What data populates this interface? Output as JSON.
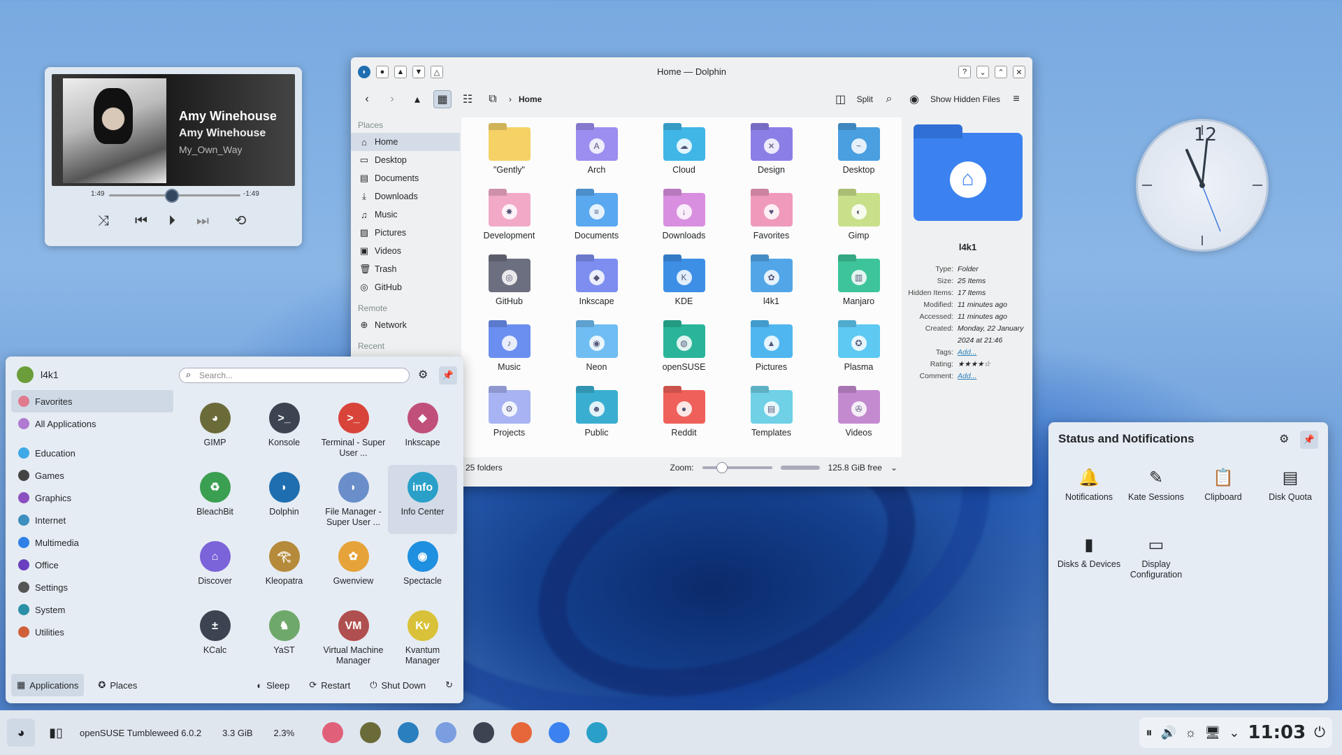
{
  "media": {
    "artist": "Amy Winehouse",
    "album": "Amy Winehouse",
    "track": "My_Own_Way",
    "elapsed": "1:49",
    "remaining": "-1:49",
    "progress": 0.5
  },
  "dolphin": {
    "title": "Home — Dolphin",
    "breadcrumb": "Home",
    "split_label": "Split",
    "hidden_label": "Show Hidden Files",
    "places_header": "Places",
    "remote_header": "Remote",
    "recent_header": "Recent",
    "places": [
      "Home",
      "Desktop",
      "Documents",
      "Downloads",
      "Music",
      "Pictures",
      "Videos",
      "Trash",
      "GitHub"
    ],
    "remote": [
      "Network"
    ],
    "folders": [
      {
        "name": "\"Gently\"",
        "color": "#f5d166",
        "sym": ""
      },
      {
        "name": "Arch",
        "color": "#9b8ef0",
        "sym": "A"
      },
      {
        "name": "Cloud",
        "color": "#3fb6e6",
        "sym": "☁"
      },
      {
        "name": "Design",
        "color": "#8b7fe6",
        "sym": "✕"
      },
      {
        "name": "Desktop",
        "color": "#4a9fe0",
        "sym": "~"
      },
      {
        "name": "Development",
        "color": "#f2a9c7",
        "sym": "✸"
      },
      {
        "name": "Documents",
        "color": "#5aa8ef",
        "sym": "≡"
      },
      {
        "name": "Downloads",
        "color": "#d98fe0",
        "sym": "↓"
      },
      {
        "name": "Favorites",
        "color": "#f09abb",
        "sym": "♥"
      },
      {
        "name": "Gimp",
        "color": "#c9e08a",
        "sym": "◐"
      },
      {
        "name": "GitHub",
        "color": "#6c6f7f",
        "sym": "◎"
      },
      {
        "name": "Inkscape",
        "color": "#7d8ef0",
        "sym": "◆"
      },
      {
        "name": "KDE",
        "color": "#3d8fe6",
        "sym": "K"
      },
      {
        "name": "l4k1",
        "color": "#52a6e8",
        "sym": "✿"
      },
      {
        "name": "Manjaro",
        "color": "#3dc49a",
        "sym": "▥"
      },
      {
        "name": "Music",
        "color": "#6b8ff0",
        "sym": "♪"
      },
      {
        "name": "Neon",
        "color": "#6fbdf2",
        "sym": "◉"
      },
      {
        "name": "openSUSE",
        "color": "#2ab59a",
        "sym": "◍"
      },
      {
        "name": "Pictures",
        "color": "#4fb6f0",
        "sym": "▲"
      },
      {
        "name": "Plasma",
        "color": "#5ec9f2",
        "sym": "✪"
      },
      {
        "name": "Projects",
        "color": "#a7b3f2",
        "sym": "⚙"
      },
      {
        "name": "Public",
        "color": "#3aaed0",
        "sym": "☻"
      },
      {
        "name": "Reddit",
        "color": "#f0605a",
        "sym": "●"
      },
      {
        "name": "Templates",
        "color": "#6fd0e6",
        "sym": "▤"
      },
      {
        "name": "Videos",
        "color": "#c48ad0",
        "sym": "✇"
      }
    ],
    "status": "25 folders",
    "zoom_label": "Zoom:",
    "free": "125.8 GiB free",
    "info": {
      "name": "l4k1",
      "rows": [
        {
          "k": "Type:",
          "v": "Folder"
        },
        {
          "k": "Size:",
          "v": "25 Items"
        },
        {
          "k": "Hidden Items:",
          "v": "17 Items"
        },
        {
          "k": "Modified:",
          "v": "11 minutes ago"
        },
        {
          "k": "Accessed:",
          "v": "11 minutes ago"
        },
        {
          "k": "Created:",
          "v": "Monday, 22 January 2024 at 21:46"
        },
        {
          "k": "Tags:",
          "v": "Add..."
        },
        {
          "k": "Rating:",
          "v": "★★★★☆"
        },
        {
          "k": "Comment:",
          "v": "Add..."
        }
      ]
    }
  },
  "launcher": {
    "user": "l4k1",
    "search_placeholder": "Search...",
    "categories": [
      {
        "name": "Favorites",
        "color": "#e07a8f"
      },
      {
        "name": "All Applications",
        "color": "#b07ad0"
      },
      {
        "name": "Education",
        "color": "#3da9e6"
      },
      {
        "name": "Games",
        "color": "#444"
      },
      {
        "name": "Graphics",
        "color": "#8b4fbf"
      },
      {
        "name": "Internet",
        "color": "#3d8fbf"
      },
      {
        "name": "Multimedia",
        "color": "#2f7fe6"
      },
      {
        "name": "Office",
        "color": "#6a3fbf"
      },
      {
        "name": "Settings",
        "color": "#555"
      },
      {
        "name": "System",
        "color": "#2a90a8"
      },
      {
        "name": "Utilities",
        "color": "#d0603a"
      }
    ],
    "apps": [
      {
        "name": "GIMP",
        "color": "#6b6b3a",
        "g": "◕"
      },
      {
        "name": "Konsole",
        "color": "#3c4452",
        "g": ">_"
      },
      {
        "name": "Terminal - Super User ...",
        "color": "#d9443a",
        "g": ">_"
      },
      {
        "name": "Inkscape",
        "color": "#c04f7a",
        "g": "◆"
      },
      {
        "name": "BleachBit",
        "color": "#3b9f52",
        "g": "♻"
      },
      {
        "name": "Dolphin",
        "color": "#1f6fb0",
        "g": "◗"
      },
      {
        "name": "File Manager - Super User ...",
        "color": "#6a8ec9",
        "g": "◗"
      },
      {
        "name": "Info Center",
        "color": "#2aa0c9",
        "g": "info"
      },
      {
        "name": "Discover",
        "color": "#7b63d9",
        "g": "⌂"
      },
      {
        "name": "Kleopatra",
        "color": "#b58a3a",
        "g": "𓂀"
      },
      {
        "name": "Gwenview",
        "color": "#e6a33a",
        "g": "✿"
      },
      {
        "name": "Spectacle",
        "color": "#1f8fe0",
        "g": "◉"
      },
      {
        "name": "KCalc",
        "color": "#3c4452",
        "g": "±"
      },
      {
        "name": "YaST",
        "color": "#6fa86b",
        "g": "♞"
      },
      {
        "name": "Virtual Machine Manager",
        "color": "#b04f4f",
        "g": "VM"
      },
      {
        "name": "Kvantum Manager",
        "color": "#d9c23a",
        "g": "Kv"
      }
    ],
    "footer": {
      "applications": "Applications",
      "places": "Places",
      "sleep": "Sleep",
      "restart": "Restart",
      "shutdown": "Shut Down"
    }
  },
  "notifications": {
    "title": "Status and Notifications",
    "items": [
      {
        "name": "Notifications",
        "g": "🔔"
      },
      {
        "name": "Kate Sessions",
        "g": "✎"
      },
      {
        "name": "Clipboard",
        "g": "📋"
      },
      {
        "name": "Disk Quota",
        "g": "▤"
      },
      {
        "name": "Disks & Devices",
        "g": "▮"
      },
      {
        "name": "Display Configuration",
        "g": "▭"
      }
    ]
  },
  "taskbar": {
    "os": "openSUSE Tumbleweed 6.0.2",
    "mem": "3.3 GiB",
    "cpu": "2.3%",
    "clock": "11:03",
    "apps": [
      "#e0607a",
      "#6b6b3a",
      "#2a7fbf",
      "#7b9ee0",
      "#3c4452",
      "#e6673a",
      "#3b82f0",
      "#2aa0c9"
    ]
  }
}
